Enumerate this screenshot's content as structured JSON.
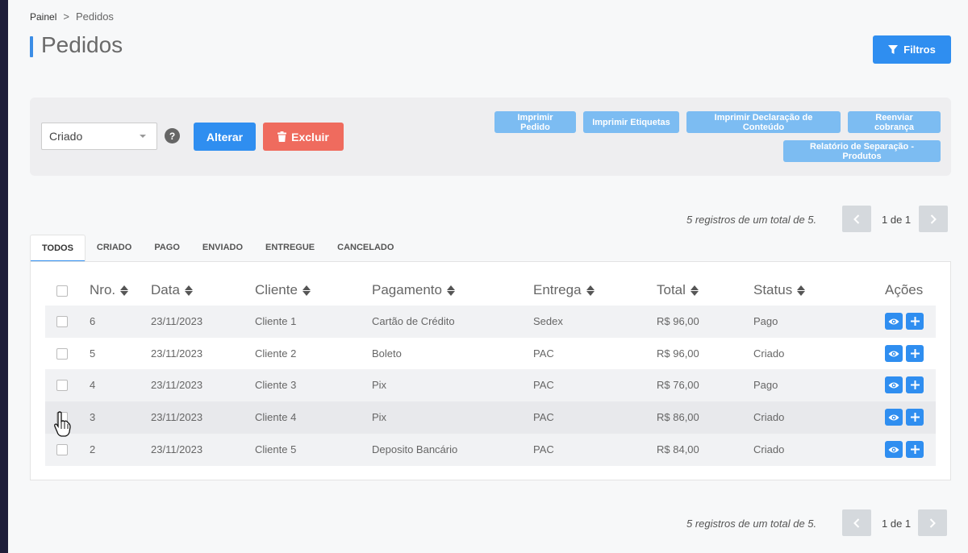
{
  "breadcrumb": {
    "home": "Painel",
    "separator": ">",
    "current": "Pedidos"
  },
  "page": {
    "title": "Pedidos"
  },
  "filter_button": {
    "label": "Filtros",
    "icon": "filter-icon"
  },
  "toolbar": {
    "status_select": {
      "value": "Criado"
    },
    "help": "?",
    "alterar_label": "Alterar",
    "excluir_label": "Excluir",
    "actions": [
      "Imprimir Pedido",
      "Imprimir Etiquetas",
      "Imprimir Declaração de Conteúdo",
      "Reenviar cobrança",
      "Relatório de Separação - Produtos"
    ]
  },
  "pagination": {
    "info": "5 registros de um total de 5.",
    "page_label": "1 de 1"
  },
  "tabs": [
    "TODOS",
    "CRIADO",
    "PAGO",
    "ENVIADO",
    "ENTREGUE",
    "CANCELADO"
  ],
  "active_tab": "TODOS",
  "table": {
    "headers": [
      "Nro.",
      "Data",
      "Cliente",
      "Pagamento",
      "Entrega",
      "Total",
      "Status",
      "Ações"
    ],
    "rows": [
      [
        "6",
        "23/11/2023",
        "Cliente 1",
        "Cartão de Crédito",
        "Sedex",
        "R$ 96,00",
        "Pago"
      ],
      [
        "5",
        "23/11/2023",
        "Cliente 2",
        "Boleto",
        "PAC",
        "R$ 96,00",
        "Criado"
      ],
      [
        "4",
        "23/11/2023",
        "Cliente 3",
        "Pix",
        "PAC",
        "R$ 76,00",
        "Pago"
      ],
      [
        "3",
        "23/11/2023",
        "Cliente 4",
        "Pix",
        "PAC",
        "R$ 86,00",
        "Criado"
      ],
      [
        "2",
        "23/11/2023",
        "Cliente 5",
        "Deposito Bancário",
        "PAC",
        "R$ 84,00",
        "Criado"
      ]
    ]
  },
  "colors": {
    "primary": "#2f8ef0",
    "danger": "#ef6b5e",
    "light_primary": "#7cbcf2",
    "sidebar": "#1f1f3a"
  }
}
